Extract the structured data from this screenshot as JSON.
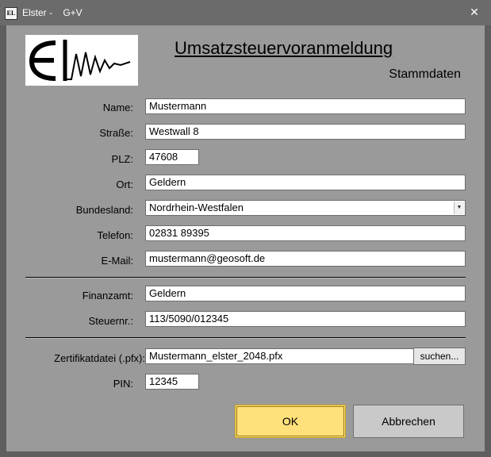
{
  "window": {
    "title": "Elster -    G+V",
    "app_icon_text": "EL",
    "close_glyph": "✕"
  },
  "header": {
    "title": "Umsatzsteuervoranmeldung",
    "subtitle": "Stammdaten"
  },
  "form": {
    "name": {
      "label": "Name:",
      "value": "Mustermann"
    },
    "strasse": {
      "label": "Straße:",
      "value": "Westwall 8"
    },
    "plz": {
      "label": "PLZ:",
      "value": "47608"
    },
    "ort": {
      "label": "Ort:",
      "value": "Geldern"
    },
    "bundesland": {
      "label": "Bundesland:",
      "value": "Nordrhein-Westfalen"
    },
    "telefon": {
      "label": "Telefon:",
      "value": "02831 89395"
    },
    "email": {
      "label": "E-Mail:",
      "value": "mustermann@geosoft.de"
    },
    "finanzamt": {
      "label": "Finanzamt:",
      "value": "Geldern"
    },
    "steuernr": {
      "label": "Steuernr.:",
      "value": "113/5090/012345"
    },
    "zertifikat": {
      "label": "Zertifikatdatei (.pfx):",
      "value": "Mustermann_elster_2048.pfx",
      "browse_label": "suchen..."
    },
    "pin": {
      "label": "PIN:",
      "value": "12345"
    }
  },
  "buttons": {
    "ok_label": "OK",
    "cancel_label": "Abbrechen"
  },
  "colors": {
    "titlebar": "#6b6b6b",
    "client_bg": "#9a9a9a",
    "ok_button": "#ffe07a"
  }
}
